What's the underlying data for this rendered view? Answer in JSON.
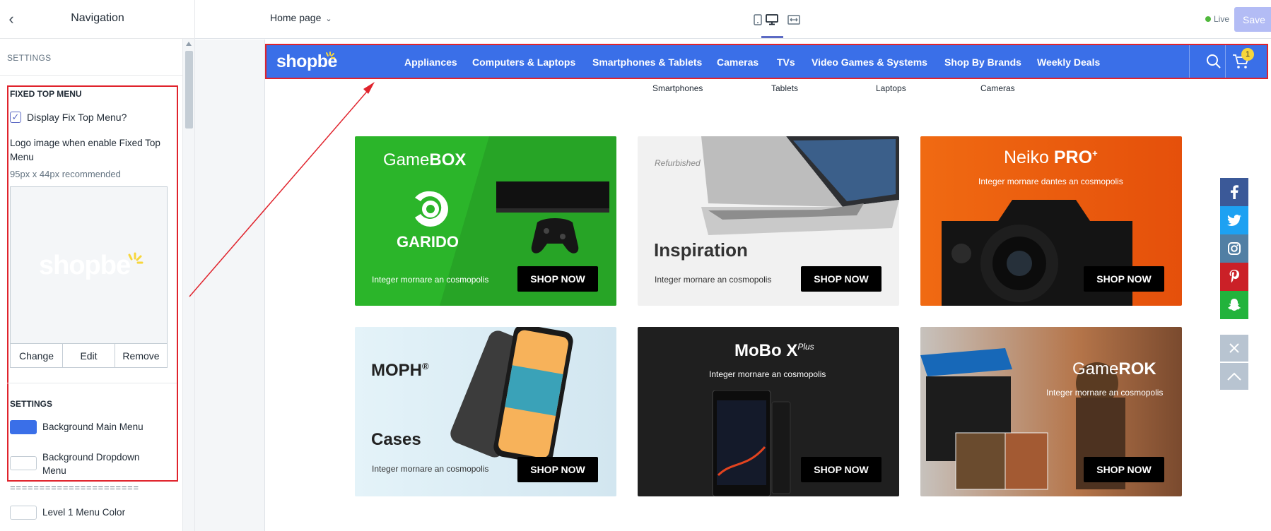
{
  "sidebar": {
    "title": "Navigation",
    "settings_caption": "SETTINGS",
    "fixed_section": {
      "heading": "FIXED TOP MENU",
      "checkbox_label": "Display Fix Top Menu?",
      "checkbox_checked": true,
      "logo_note": "Logo image when enable Fixed Top Menu",
      "logo_hint": "95px x 44px recommended",
      "logo_preview_text": "shopbe",
      "buttons": [
        "Change",
        "Edit",
        "Remove"
      ]
    },
    "settings_section": {
      "heading": "SETTINGS",
      "items": [
        {
          "label": "Background Main Menu",
          "color": "#3a6fe8"
        },
        {
          "label": "Background Dropdown Menu",
          "color": "#ffffff"
        }
      ]
    },
    "separator": "======================",
    "level1": {
      "label": "Level 1 Menu Color",
      "color": "#ffffff"
    }
  },
  "topbar": {
    "page_selector": "Home page",
    "devices": [
      "mobile",
      "desktop",
      "full-width"
    ],
    "active_device": "desktop",
    "live_label": "Live",
    "save_label": "Save"
  },
  "store": {
    "logo": "shopbe",
    "menu": [
      "Appliances",
      "Computers & Laptops",
      "Smartphones & Tablets",
      "Cameras",
      "TVs",
      "Video Games & Systems",
      "Shop By Brands",
      "Weekly Deals"
    ],
    "cart_count": "1",
    "sub_links": [
      "Smartphones",
      "Tablets",
      "Laptops",
      "Cameras"
    ],
    "banners": [
      {
        "title_a": "Game",
        "title_b": "BOX",
        "brand": "GARIDO",
        "caption": "Integer mornare an cosmopolis",
        "button": "SHOP NOW",
        "bg": "#2bb52a"
      },
      {
        "tag": "Refurbished",
        "title": "Inspiration",
        "caption": "Integer mornare an cosmopolis",
        "button": "SHOP NOW",
        "bg": "#f1f1f1"
      },
      {
        "title_a": "Neiko ",
        "title_b": "PRO",
        "sup": "+",
        "caption": "Integer mornare dantes an cosmopolis",
        "button": "SHOP NOW",
        "bg": "#f06a12"
      },
      {
        "title": "MOPH",
        "sup": "®",
        "title2": "Cases",
        "caption": "Integer mornare an cosmopolis",
        "button": "SHOP NOW",
        "bg": "#d9ecf5"
      },
      {
        "title": "MoBo X",
        "sup": "Plus",
        "caption": "Integer mornare an cosmopolis",
        "button": "SHOP NOW",
        "bg": "#1f1f1f"
      },
      {
        "title_a": "Game",
        "title_b": "ROK",
        "caption": "Integer mornare an cosmopolis",
        "button": "SHOP NOW",
        "bg": "#b5754a"
      }
    ],
    "social": [
      {
        "name": "facebook",
        "color": "#3b5998"
      },
      {
        "name": "twitter",
        "color": "#1da1f2"
      },
      {
        "name": "instagram",
        "color": "#517fa4"
      },
      {
        "name": "pinterest",
        "color": "#cb2027"
      },
      {
        "name": "snapchat",
        "color": "#22b33c"
      }
    ]
  }
}
